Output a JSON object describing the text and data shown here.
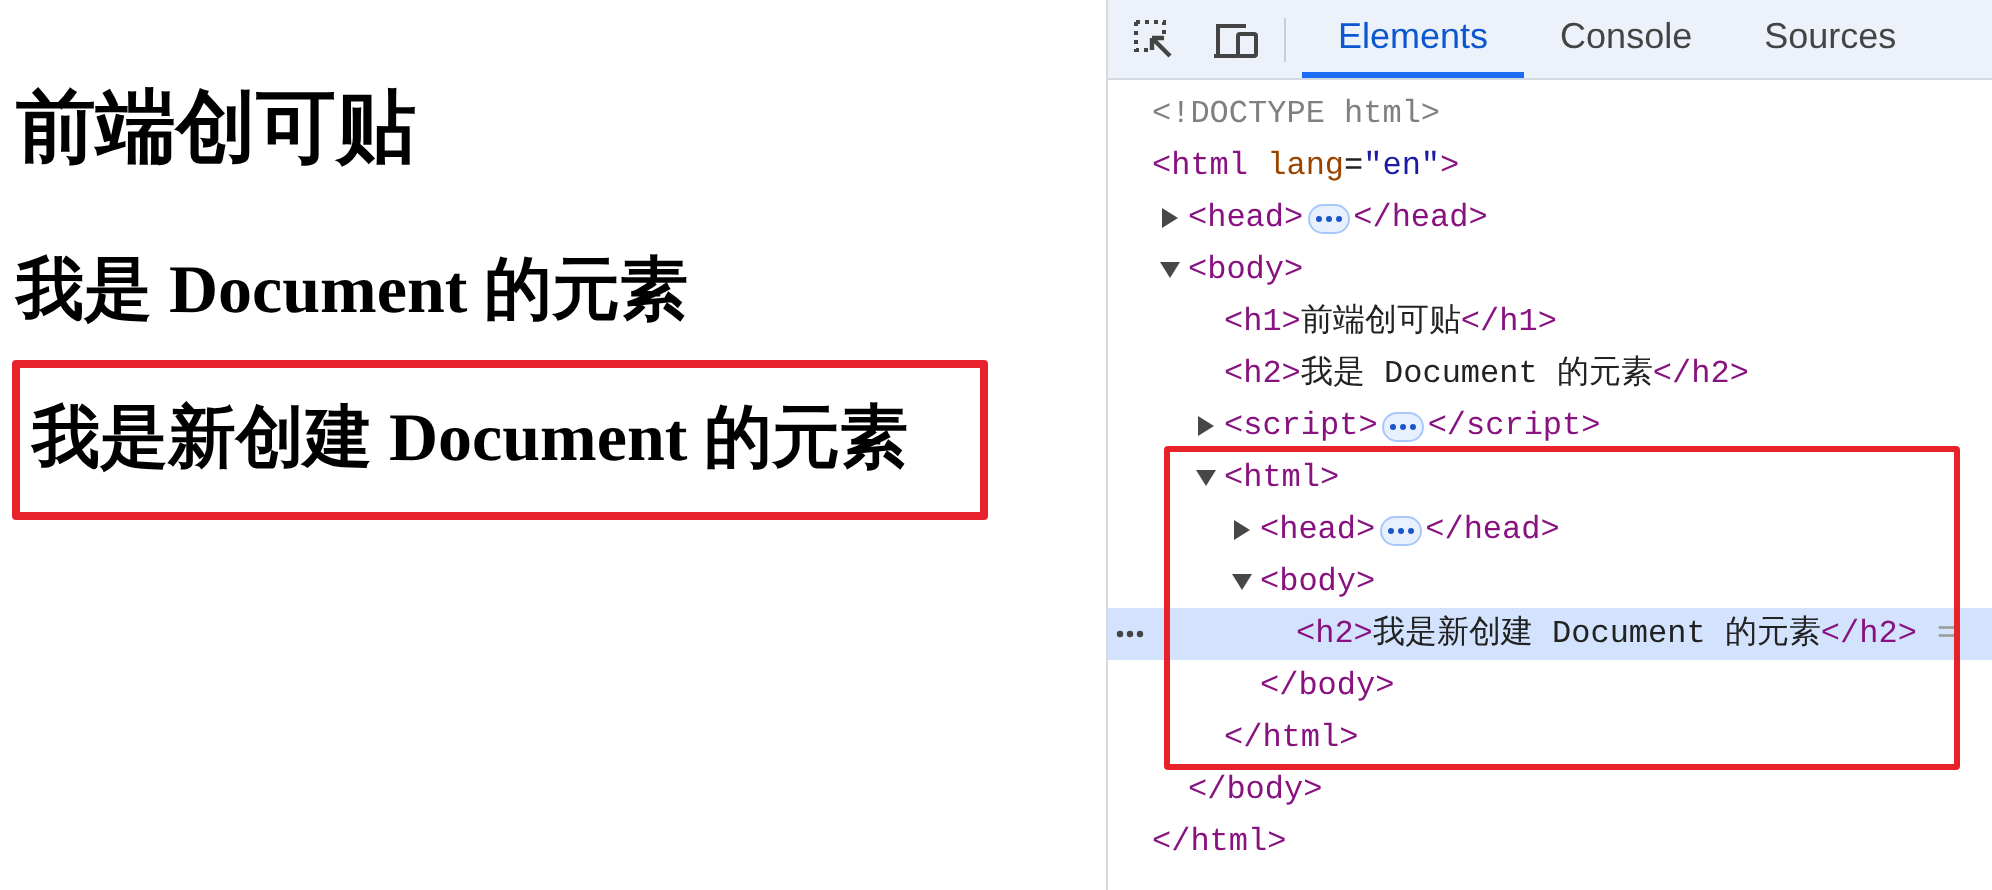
{
  "page": {
    "headings": [
      {
        "kind": "h1",
        "text": "前端创可贴",
        "annotated": false
      },
      {
        "kind": "h2",
        "text": "我是 Document 的元素",
        "annotated": false
      },
      {
        "kind": "h2",
        "text": "我是新创建 Document 的元素",
        "annotated": true
      }
    ]
  },
  "devtools": {
    "tabs": [
      {
        "label": "Elements",
        "selected": true
      },
      {
        "label": "Console",
        "selected": false
      },
      {
        "label": "Sources",
        "selected": false
      }
    ],
    "tree": [
      {
        "selected": false,
        "annotated": false,
        "parts": [
          {
            "kind": "code",
            "segments": [
              {
                "kind": "doctype",
                "text": "<!DOCTYPE html>"
              }
            ]
          }
        ]
      },
      {
        "selected": false,
        "annotated": false,
        "parts": [
          {
            "kind": "code",
            "segments": [
              {
                "kind": "tag",
                "text": "<html "
              },
              {
                "kind": "attr",
                "text": "lang"
              },
              {
                "kind": "text",
                "text": "="
              },
              {
                "kind": "value",
                "text": "\"en\""
              },
              {
                "kind": "tag",
                "text": ">"
              }
            ]
          }
        ],
        "close": [
          {
            "kind": "tag",
            "text": "</html>"
          }
        ],
        "children": [
          {
            "selected": false,
            "annotated": false,
            "expanded": false,
            "parts": [
              {
                "kind": "code",
                "segments": [
                  {
                    "kind": "tag",
                    "text": "<head>"
                  }
                ]
              },
              {
                "kind": "ellipsis"
              },
              {
                "kind": "code",
                "segments": [
                  {
                    "kind": "tag",
                    "text": "</head>"
                  }
                ]
              }
            ]
          },
          {
            "selected": false,
            "annotated": false,
            "expanded": true,
            "parts": [
              {
                "kind": "code",
                "segments": [
                  {
                    "kind": "tag",
                    "text": "<body>"
                  }
                ]
              }
            ],
            "close": [
              {
                "kind": "tag",
                "text": "</body>"
              }
            ],
            "children": [
              {
                "selected": false,
                "annotated": false,
                "parts": [
                  {
                    "kind": "code",
                    "segments": [
                      {
                        "kind": "tag",
                        "text": "<h1>"
                      },
                      {
                        "kind": "text",
                        "text": "前端创可贴"
                      },
                      {
                        "kind": "tag",
                        "text": "</h1>"
                      }
                    ]
                  }
                ]
              },
              {
                "selected": false,
                "annotated": false,
                "parts": [
                  {
                    "kind": "code",
                    "segments": [
                      {
                        "kind": "tag",
                        "text": "<h2>"
                      },
                      {
                        "kind": "text",
                        "text": "我是 Document 的元素"
                      },
                      {
                        "kind": "tag",
                        "text": "</h2>"
                      }
                    ]
                  }
                ]
              },
              {
                "selected": false,
                "annotated": false,
                "expanded": false,
                "parts": [
                  {
                    "kind": "code",
                    "segments": [
                      {
                        "kind": "tag",
                        "text": "<script>"
                      }
                    ]
                  },
                  {
                    "kind": "ellipsis"
                  },
                  {
                    "kind": "code",
                    "segments": [
                      {
                        "kind": "tag",
                        "text": "</script>"
                      }
                    ]
                  }
                ]
              },
              {
                "selected": false,
                "annotated": true,
                "expanded": true,
                "parts": [
                  {
                    "kind": "code",
                    "segments": [
                      {
                        "kind": "tag",
                        "text": "<html>"
                      }
                    ]
                  }
                ],
                "close": [
                  {
                    "kind": "tag",
                    "text": "</html>"
                  }
                ],
                "children": [
                  {
                    "selected": false,
                    "annotated": false,
                    "expanded": false,
                    "parts": [
                      {
                        "kind": "code",
                        "segments": [
                          {
                            "kind": "tag",
                            "text": "<head>"
                          }
                        ]
                      },
                      {
                        "kind": "ellipsis"
                      },
                      {
                        "kind": "code",
                        "segments": [
                          {
                            "kind": "tag",
                            "text": "</head>"
                          }
                        ]
                      }
                    ]
                  },
                  {
                    "selected": false,
                    "annotated": false,
                    "expanded": true,
                    "parts": [
                      {
                        "kind": "code",
                        "segments": [
                          {
                            "kind": "tag",
                            "text": "<body>"
                          }
                        ]
                      }
                    ],
                    "close": [
                      {
                        "kind": "tag",
                        "text": "</body>"
                      }
                    ],
                    "children": [
                      {
                        "selected": true,
                        "annotated": false,
                        "parts": [
                          {
                            "kind": "code",
                            "segments": [
                              {
                                "kind": "tag",
                                "text": "<h2>"
                              },
                              {
                                "kind": "text",
                                "text": "我是新创建 Document 的元素"
                              },
                              {
                                "kind": "tag",
                                "text": "</h2>"
                              }
                            ]
                          },
                          {
                            "kind": "code",
                            "segments": [
                              {
                                "kind": "muted",
                                "text": "="
                              }
                            ]
                          }
                        ]
                      }
                    ]
                  }
                ]
              }
            ]
          }
        ]
      }
    ]
  }
}
